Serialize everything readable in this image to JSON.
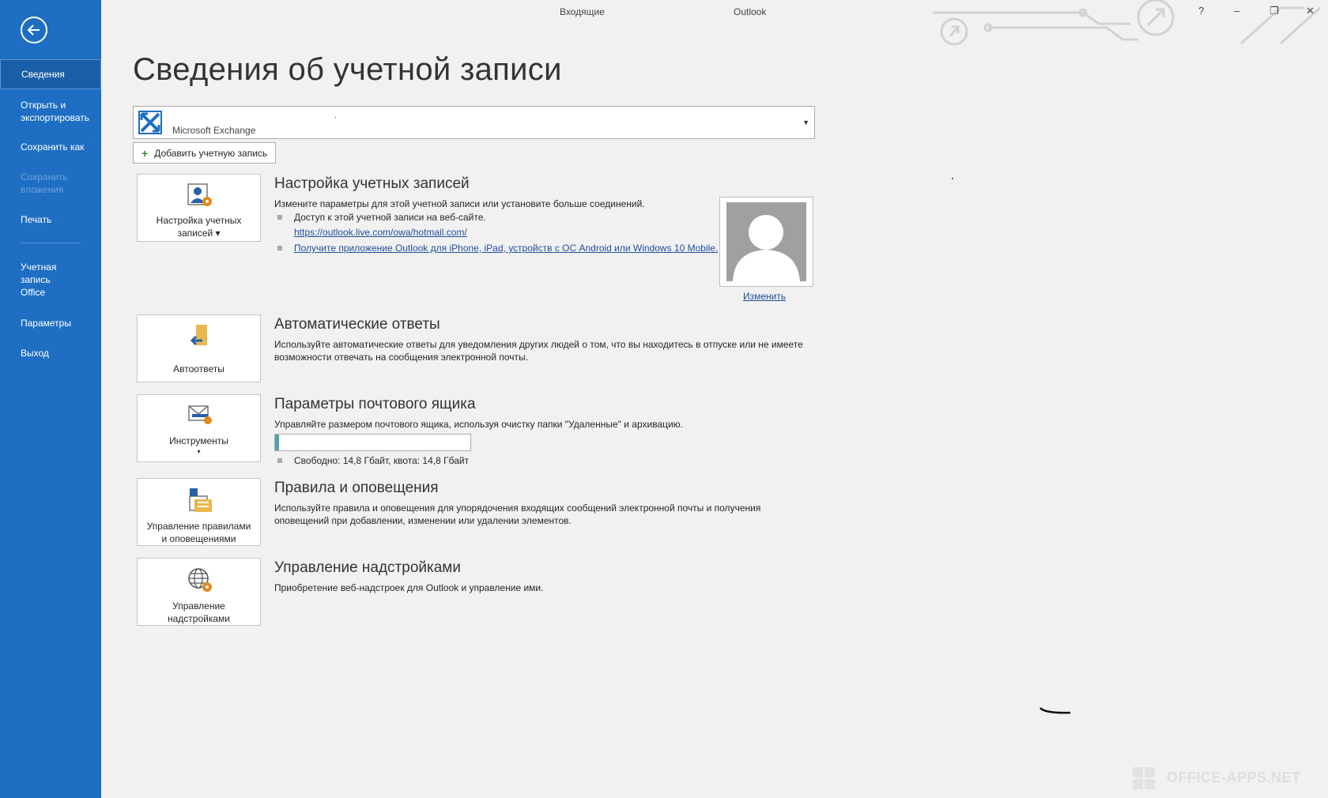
{
  "titlebar": {
    "folder": "Входящие",
    "app": "Outlook",
    "help": "?",
    "minimize": "–",
    "restore": "❐",
    "close": "✕"
  },
  "sidebar": {
    "items": [
      {
        "label": "Сведения",
        "state": "active"
      },
      {
        "label": "Открыть и экспортировать",
        "state": "normal"
      },
      {
        "label": "Сохранить как",
        "state": "normal"
      },
      {
        "label": "Сохранить вложения",
        "state": "disabled"
      },
      {
        "label": "Печать",
        "state": "normal"
      },
      {
        "label": "Учетная запись Office",
        "state": "normal"
      },
      {
        "label": "Параметры",
        "state": "normal"
      },
      {
        "label": "Выход",
        "state": "normal"
      }
    ]
  },
  "main": {
    "title": "Сведения об учетной записи",
    "account": {
      "name": ".",
      "type": "Microsoft Exchange",
      "icon": "exchange-icon"
    },
    "add_account_label": "Добавить учетную запись",
    "sections": {
      "account_settings": {
        "tile_label_1": "Настройка учетных",
        "tile_label_2": "записей ▾",
        "title": "Настройка учетных записей",
        "description": "Измените параметры для этой учетной записи или установите больше соединений.",
        "bullet_1": "Доступ к этой учетной записи на веб-сайте.",
        "link_1": "https://outlook.live.com/owa/hotmail.com/",
        "link_2": "Получите приложение Outlook для iPhone, iPad, устройств с ОС Android или Windows 10 Mobile.",
        "change_photo": "Изменить"
      },
      "auto_replies": {
        "tile_label": "Автоответы",
        "title": "Автоматические ответы",
        "desc_1": "Используйте автоматические ответы для уведомления других людей о том, что вы находитесь в отпуске или не имеете",
        "desc_2": "возможности отвечать на сообщения электронной почты."
      },
      "mailbox": {
        "tile_label": "Инструменты",
        "tile_caret": "▾",
        "title": "Параметры почтового ящика",
        "description": "Управляйте размером почтового ящика, используя очистку папки \"Удаленные\" и архивацию.",
        "usage_fraction": 0.02,
        "free_text": "Свободно: 14,8 Гбайт, квота: 14,8 Гбайт"
      },
      "rules": {
        "tile_label_1": "Управление правилами",
        "tile_label_2": "и оповещениями",
        "title": "Правила и оповещения",
        "desc_1": "Используйте правила и оповещения для упорядочения входящих сообщений электронной почты и получения",
        "desc_2": "оповещений при добавлении, изменении или удалении элементов."
      },
      "addins": {
        "tile_label_1": "Управление",
        "tile_label_2": "надстройками",
        "title": "Управление надстройками",
        "description": "Приобретение веб-надстроек для Outlook и управление ими."
      }
    }
  },
  "watermark": "OFFICE-APPS.NET",
  "colors": {
    "sidebar": "#1e6fc4",
    "sidebar_active": "#1a5ea8",
    "link": "#1f4e9c",
    "progress_fill": "#4ea3ad"
  }
}
